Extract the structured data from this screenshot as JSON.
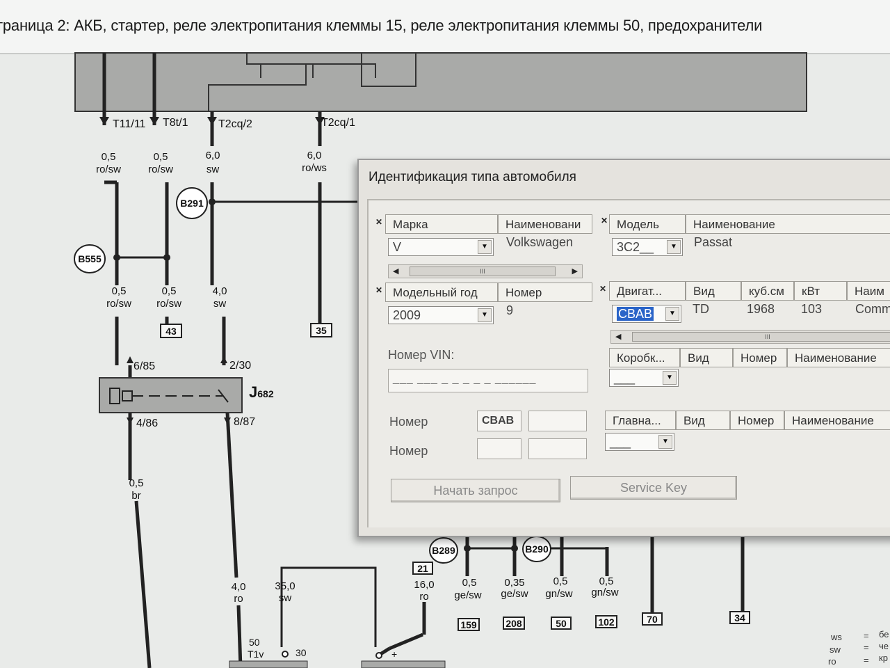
{
  "window": {
    "title": "траница 2: АКБ, стартер, реле электропитания клеммы 15, реле электропитания клеммы 50, предохранители"
  },
  "diagram": {
    "connectors": [
      "T11/11",
      "T8t/1",
      "T2cq/2",
      "T2cq/1"
    ],
    "wires_top": [
      {
        "size": "0,5",
        "color": "ro/sw"
      },
      {
        "size": "0,5",
        "color": "ro/sw"
      },
      {
        "size": "6,0",
        "color": "sw"
      },
      {
        "size": "6,0",
        "color": "ro/ws"
      }
    ],
    "wires_mid": [
      {
        "size": "0,5",
        "color": "ro/sw"
      },
      {
        "size": "0,5",
        "color": "ro/sw"
      },
      {
        "size": "4,0",
        "color": "sw"
      }
    ],
    "nodes": {
      "b291": "B291",
      "b555": "B555",
      "b289": "B289",
      "b290": "B290"
    },
    "refs": {
      "r43": "43",
      "r35": "35",
      "r21": "21",
      "r70": "70",
      "r34": "34"
    },
    "relay": {
      "name": "J",
      "sub": "682",
      "pin_in1": "6/85",
      "pin_in2": "2/30",
      "pin_out1": "4/86",
      "pin_out2": "8/87"
    },
    "wire_br": {
      "size": "0,5",
      "color": "br"
    },
    "wires_bottom": [
      {
        "size": "4,0",
        "color": "ro"
      },
      {
        "size": "35,0",
        "color": "sw"
      },
      {
        "size": "16,0",
        "color": "ro"
      },
      {
        "size": "0,5",
        "color": "ge/sw"
      },
      {
        "size": "0,35",
        "color": "ge/sw"
      },
      {
        "size": "0,5",
        "color": "gn/sw"
      },
      {
        "size": "0,5",
        "color": "gn/sw"
      }
    ],
    "refs_bottom": [
      "159",
      "208",
      "50",
      "102"
    ],
    "terminals": {
      "t50": "50",
      "t1v": "T1v",
      "t30": "30",
      "plus": "+"
    },
    "legend": [
      {
        "code": "ws",
        "eq": "=",
        "text": "бе"
      },
      {
        "code": "sw",
        "eq": "=",
        "text": "че"
      },
      {
        "code": "ro",
        "eq": "=",
        "text": "кр"
      }
    ]
  },
  "dialog": {
    "title": "Идентификация типа автомобиля",
    "brand": {
      "header": [
        "Марка",
        "Наименовани"
      ],
      "value": "V",
      "name": "Volkswagen"
    },
    "model": {
      "header": [
        "Модель",
        "Наименование"
      ],
      "value": "3C2__",
      "name": "Passat"
    },
    "year": {
      "header": [
        "Модельный год",
        "Номер"
      ],
      "value": "2009",
      "number": "9"
    },
    "engine": {
      "header": [
        "Двигат...",
        "Вид",
        "куб.см",
        "кВт",
        "Наим"
      ],
      "value": "CBAB",
      "type": "TD",
      "ccm": "1968",
      "kw": "103",
      "name": "Comm"
    },
    "vin_label": "Номер VIN:",
    "vin_mask": "___ ___ _ _ _ _ _ ______",
    "gearbox": {
      "header": [
        "Коробк...",
        "Вид",
        "Номер",
        "Наименование"
      ],
      "value": "___"
    },
    "maingear": {
      "header": [
        "Главна...",
        "Вид",
        "Номер",
        "Наименование"
      ],
      "value": "___"
    },
    "number_label_1": "Номер",
    "number_label_2": "Номер",
    "number_value": "CBAB",
    "scroll_thumb": "III",
    "start_button": "Начать запрос",
    "service_button": "Service Key"
  }
}
